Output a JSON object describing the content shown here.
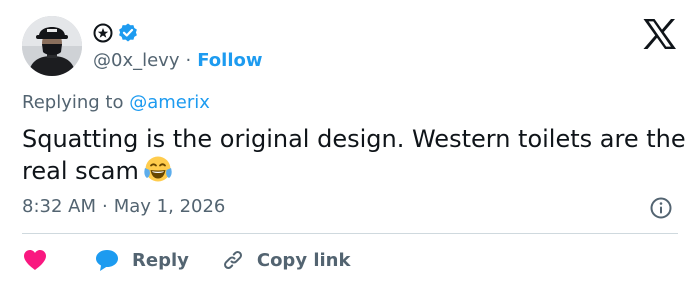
{
  "header": {
    "handle": "@0x_levy",
    "separator": "·",
    "follow_label": "Follow",
    "x_logo": "x-logo-icon",
    "avatar": "avatar-image"
  },
  "tweet": {
    "replying_prefix": "Replying to",
    "replying_handle": "@amerix",
    "text": "Squatting is the original design. Western toilets are the real scam",
    "emoji": "face-with-tears-of-joy-emoji",
    "time": "8:32 AM",
    "separator": "·",
    "date": "May 1, 2026"
  },
  "actions": {
    "reply_label": "Reply",
    "copy_link_label": "Copy link"
  },
  "icons": {
    "like": "heart-icon",
    "reply": "speech-bubble-icon",
    "copy_link": "link-icon",
    "info": "info-icon",
    "verified": "verified-badge-icon",
    "affiliate": "badge-star-icon"
  },
  "colors": {
    "accent": "#1d9bf0",
    "like": "#f91880",
    "text": "#0f1419",
    "muted": "#536471",
    "divider": "#cfd9de"
  }
}
